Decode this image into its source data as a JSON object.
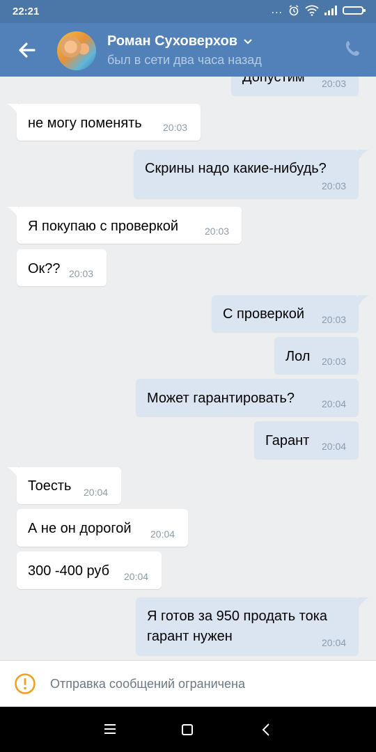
{
  "status_bar": {
    "time": "22:21",
    "dots": "..."
  },
  "header": {
    "name": "Роман Суховерхов",
    "presence": "был в сети два часа назад"
  },
  "messages": [
    {
      "dir": "out",
      "text": "Допустим",
      "time": "20:03"
    },
    {
      "dir": "in",
      "text": "не могу поменять",
      "time": "20:03"
    },
    {
      "dir": "out",
      "text": "Скрины надо какие-нибудь?",
      "time": "20:03"
    },
    {
      "dir": "in",
      "text": "Я покупаю с проверкой",
      "time": "20:03"
    },
    {
      "dir": "in",
      "text": "Ок??",
      "time": "20:03"
    },
    {
      "dir": "out",
      "text": "С проверкой",
      "time": "20:03"
    },
    {
      "dir": "out",
      "text": "Лол",
      "time": "20:03"
    },
    {
      "dir": "out",
      "text": "Может гарантировать?",
      "time": "20:04"
    },
    {
      "dir": "out",
      "text": "Гарант",
      "time": "20:04"
    },
    {
      "dir": "in",
      "text": "Тоесть",
      "time": "20:04"
    },
    {
      "dir": "in",
      "text": "А не он дорогой",
      "time": "20:04"
    },
    {
      "dir": "in",
      "text": "300 -400 руб",
      "time": "20:04"
    },
    {
      "dir": "out",
      "text": "Я готов за 950 продать тока",
      "text2": "гарант нужен",
      "time": "20:04"
    }
  ],
  "notice": {
    "text": "Отправка сообщений ограничена"
  },
  "colors": {
    "header": "#5181b8",
    "statusbar": "#4a76a8",
    "bubble_out": "#dbe5f1",
    "bubble_in": "#ffffff",
    "warning": "#f0a020"
  },
  "icons": [
    "back-arrow-icon",
    "chevron-down-icon",
    "phone-icon",
    "warning-icon",
    "menu-icon",
    "home-icon",
    "nav-back-icon"
  ]
}
